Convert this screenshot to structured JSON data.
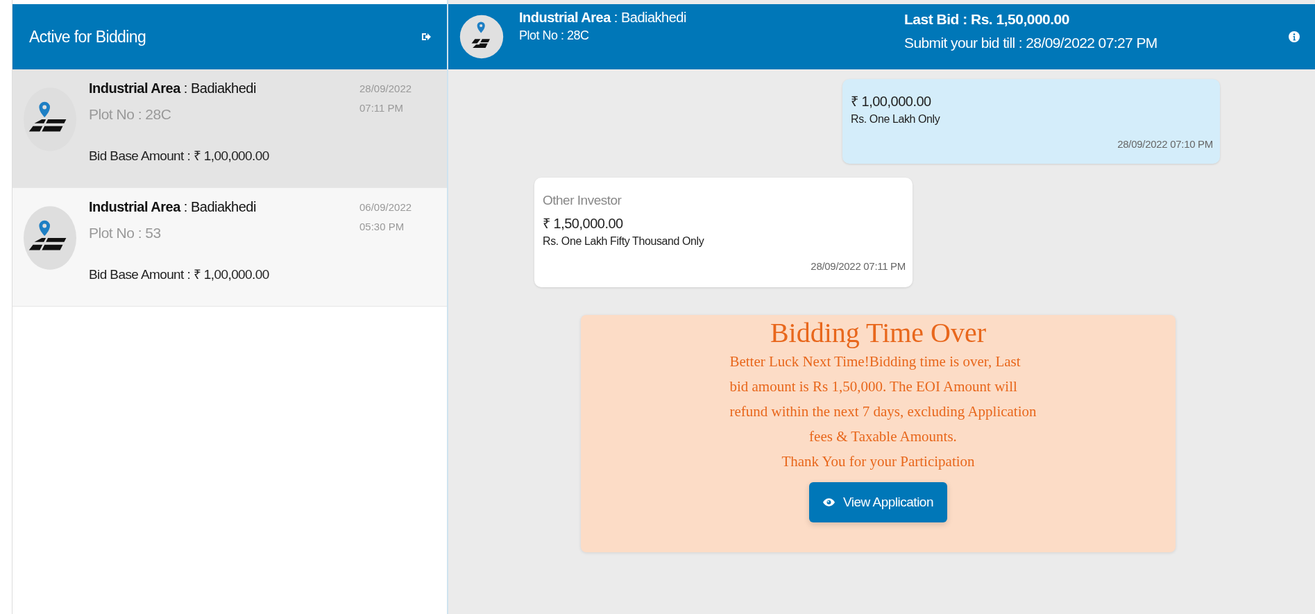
{
  "sidebar": {
    "title": "Active for Bidding",
    "items": [
      {
        "area": "**Industrial Area** : Badiakhedi",
        "plot": "Plot No : 28C",
        "base_amount": "Bid Base Amount : ₹ 1,00,000.00",
        "date": "28/09/2022",
        "time": "07:11 PM",
        "selected": true
      },
      {
        "area": "**Industrial Area** : Badiakhedi",
        "plot": "Plot No : 53",
        "base_amount": "Bid Base Amount : ₹ 1,00,000.00",
        "date": "06/09/2022",
        "time": "05:30 PM",
        "selected": false
      }
    ]
  },
  "chat_header": {
    "area": "**Industrial Area** : Badiakhedi",
    "plot": "Plot No : 28C",
    "last_bid": "Last Bid : Rs. 1,50,000.00",
    "deadline": "Submit your bid till : 28/09/2022 07:27 PM"
  },
  "messages": [
    {
      "kind": "mine",
      "amount": "₹ 1,00,000.00",
      "words": "Rs. One Lakh Only",
      "timestamp": "28/09/2022 07:10 PM"
    },
    {
      "kind": "other",
      "sender": "Other Investor",
      "amount": "₹ 1,50,000.00",
      "words": "Rs. One Lakh Fifty Thousand Only",
      "timestamp": "28/09/2022 07:11 PM"
    }
  ],
  "notice": {
    "title": "Bidding Time Over",
    "lines": [
      "Better Luck Next Time!Bidding time is over, Last",
      "bid amount is Rs 1,50,000.  The EOI Amount will",
      "refund within the next 7 days, excluding Application",
      "fees & Taxable Amounts."
    ],
    "thanks": "Thank You for your Participation",
    "button": "View Application"
  }
}
